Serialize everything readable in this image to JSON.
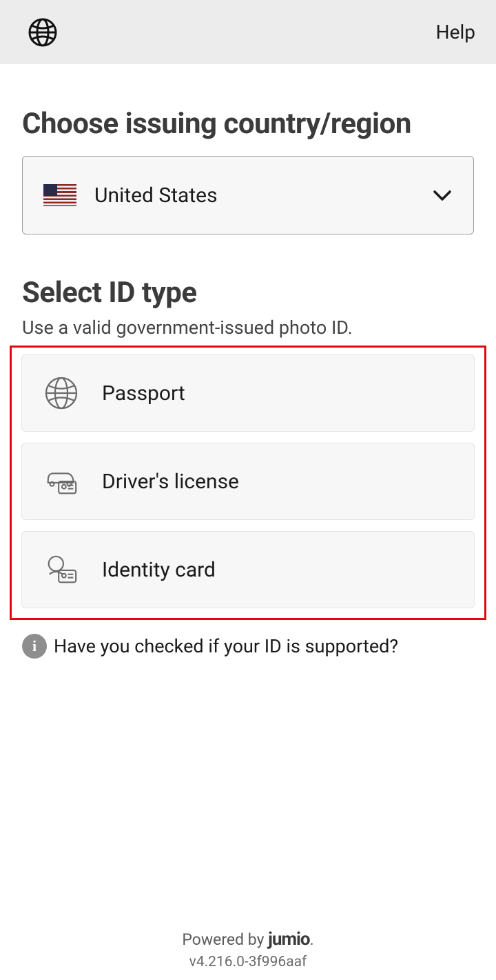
{
  "header": {
    "help_label": "Help"
  },
  "country": {
    "title": "Choose issuing country/region",
    "selected": "United States"
  },
  "idtype": {
    "title": "Select ID type",
    "hint": "Use a valid government-issued photo ID.",
    "options": [
      {
        "label": "Passport"
      },
      {
        "label": "Driver's license"
      },
      {
        "label": "Identity card"
      }
    ]
  },
  "support": {
    "text": "Have you checked if your ID is supported?"
  },
  "footer": {
    "powered_prefix": "Powered by ",
    "brand": "jumio",
    "version": "v4.216.0-3f996aaf"
  }
}
